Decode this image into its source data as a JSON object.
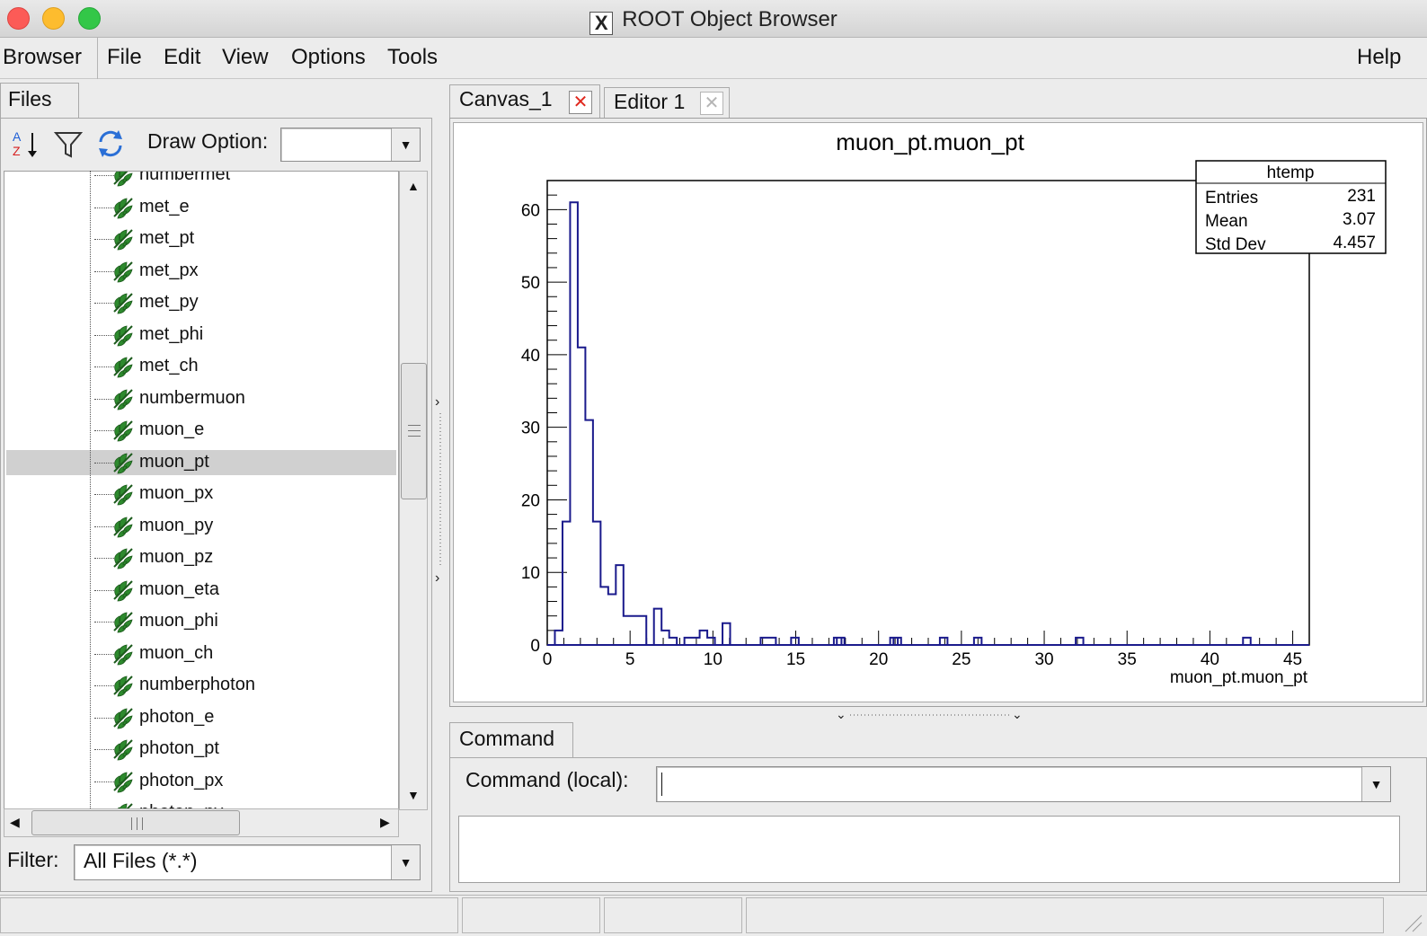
{
  "window": {
    "title": "ROOT Object Browser"
  },
  "menu": {
    "browser": "Browser",
    "file": "File",
    "edit": "Edit",
    "view": "View",
    "options": "Options",
    "tools": "Tools",
    "help": "Help"
  },
  "left": {
    "tab": "Files",
    "draw_option_label": "Draw Option:",
    "draw_option_value": "",
    "filter_label": "Filter:",
    "filter_value": "All Files (*.*)",
    "tree_items": [
      "numbermet",
      "met_e",
      "met_pt",
      "met_px",
      "met_py",
      "met_phi",
      "met_ch",
      "numbermuon",
      "muon_e",
      "muon_pt",
      "muon_px",
      "muon_py",
      "muon_pz",
      "muon_eta",
      "muon_phi",
      "muon_ch",
      "numberphoton",
      "photon_e",
      "photon_pt",
      "photon_px",
      "photon_py"
    ],
    "selected_item": "muon_pt",
    "icons": {
      "sort": "sort-az-icon",
      "filter": "filter-funnel-icon",
      "refresh": "refresh-icon",
      "leaf": "tree-leaf-icon"
    }
  },
  "tabs": {
    "canvas": "Canvas_1",
    "editor": "Editor 1"
  },
  "command": {
    "tab": "Command",
    "label": "Command (local):",
    "value": ""
  },
  "colors": {
    "histogram_line": "#1a1a8c",
    "close_active": "#e0281e"
  },
  "chart_data": {
    "type": "bar",
    "title": "muon_pt.muon_pt",
    "xlabel": "muon_pt.muon_pt",
    "ylabel": "",
    "xlim": [
      0,
      46
    ],
    "ylim": [
      0,
      64
    ],
    "xticks": [
      0,
      5,
      10,
      15,
      20,
      25,
      30,
      35,
      40,
      45
    ],
    "yticks": [
      0,
      10,
      20,
      30,
      40,
      50,
      60
    ],
    "bin_width": 0.46,
    "bins_start": 0.46,
    "values": [
      2,
      17,
      61,
      41,
      31,
      17,
      8,
      7,
      11,
      4,
      4,
      4,
      0,
      5,
      2,
      1,
      0,
      1,
      1,
      2,
      1,
      0,
      3,
      0,
      0,
      0,
      0,
      1,
      1,
      0,
      0,
      1,
      0,
      0,
      0,
      0,
      0,
      1,
      0,
      0,
      0,
      0,
      0,
      0,
      1,
      0,
      0,
      0,
      0,
      0,
      0,
      0,
      0,
      0,
      0,
      1,
      0,
      0,
      0,
      0,
      0,
      0,
      0,
      0,
      0,
      0,
      0,
      0,
      0,
      0,
      0,
      0,
      0,
      0,
      0,
      0,
      0,
      0,
      0,
      0,
      0,
      0,
      0,
      0,
      0,
      0,
      0,
      0,
      0,
      0,
      0
    ],
    "extra_bins": [
      [
        17.3,
        1
      ],
      [
        20.9,
        1
      ],
      [
        23.7,
        1
      ],
      [
        31.9,
        1
      ],
      [
        42.0,
        1
      ]
    ],
    "stats": {
      "name": "htemp",
      "rows": [
        {
          "label": "Entries",
          "value": "231"
        },
        {
          "label": "Mean",
          "value": "3.07"
        },
        {
          "label": "Std Dev",
          "value": "4.457"
        }
      ]
    }
  }
}
